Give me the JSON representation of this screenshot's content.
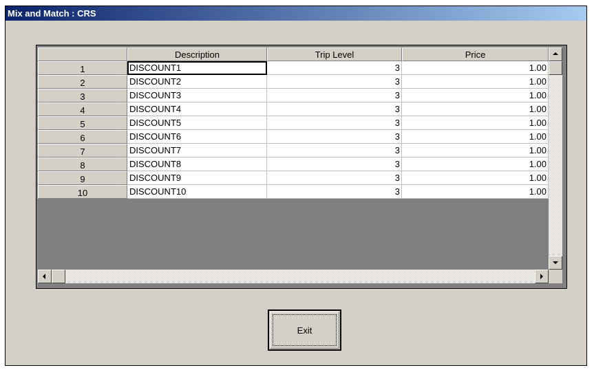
{
  "window": {
    "title": "Mix and Match :  CRS"
  },
  "grid": {
    "columns": [
      "",
      "Description",
      "Trip Level",
      "Price"
    ],
    "rows": [
      {
        "index": "1",
        "description": "DISCOUNT1",
        "trip_level": "3",
        "price": "1.00"
      },
      {
        "index": "2",
        "description": "DISCOUNT2",
        "trip_level": "3",
        "price": "1.00"
      },
      {
        "index": "3",
        "description": "DISCOUNT3",
        "trip_level": "3",
        "price": "1.00"
      },
      {
        "index": "4",
        "description": "DISCOUNT4",
        "trip_level": "3",
        "price": "1.00"
      },
      {
        "index": "5",
        "description": "DISCOUNT5",
        "trip_level": "3",
        "price": "1.00"
      },
      {
        "index": "6",
        "description": "DISCOUNT6",
        "trip_level": "3",
        "price": "1.00"
      },
      {
        "index": "7",
        "description": "DISCOUNT7",
        "trip_level": "3",
        "price": "1.00"
      },
      {
        "index": "8",
        "description": "DISCOUNT8",
        "trip_level": "3",
        "price": "1.00"
      },
      {
        "index": "9",
        "description": "DISCOUNT9",
        "trip_level": "3",
        "price": "1.00"
      },
      {
        "index": "10",
        "description": "DISCOUNT10",
        "trip_level": "3",
        "price": "1.00"
      }
    ]
  },
  "buttons": {
    "exit_label": "Exit"
  }
}
